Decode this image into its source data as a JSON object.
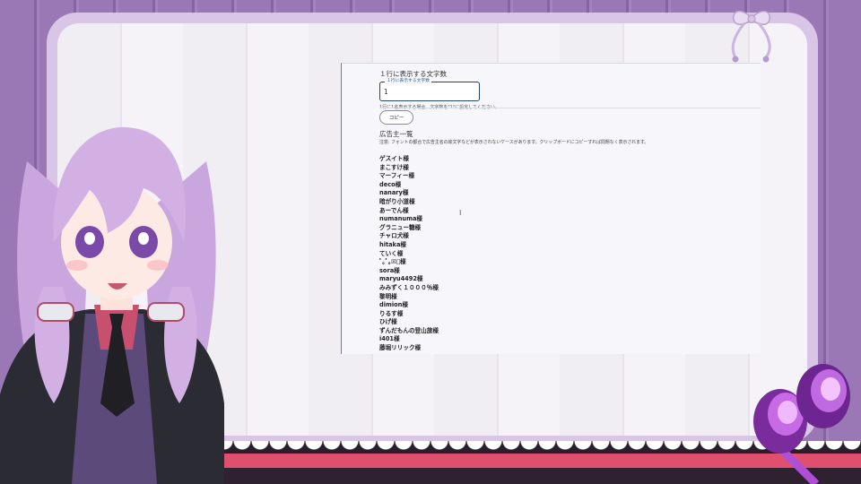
{
  "settings": {
    "label": "１行に表示する文字数",
    "field_legend": "１行に表示する文字数",
    "field_value": "1",
    "hint": "1行に1名表示する場合、文字数を\"1\"に設定してください。",
    "copy_label": "コピー"
  },
  "sponsors": {
    "title": "広告主一覧",
    "note": "注意: フォントの都合で広告主名の絵文字などが表示されないケースがあります。クリップボードにコピーすれば問題なく表示されます。",
    "names": [
      "ゲスイト様",
      "まこすけ様",
      "マーフィー様",
      "deco様",
      "nanary様",
      "暗がり小道様",
      "あーでん様",
      "numanuma様",
      "グラニュー糖様",
      "チャロ犬様",
      "hitaka様",
      "ていく様",
      "ﾟ｡ﾟ｡☒ﾟ様",
      "sora様",
      "maryu4492様",
      "みみずく１０００％様",
      "黎明様",
      "dimion様",
      "りるす様",
      "ひげ様",
      "ずんだもんの登山旅様",
      "i401様",
      "藤堀リリック様"
    ]
  },
  "colors": {
    "accent": "#23456e",
    "stage_purple": "#9a78b6",
    "stripe_pink": "#e0506e"
  }
}
